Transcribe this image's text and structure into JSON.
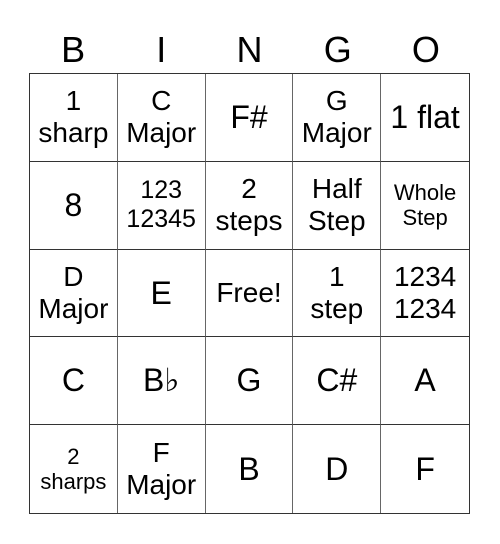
{
  "header": [
    "B",
    "I",
    "N",
    "G",
    "O"
  ],
  "cells": [
    {
      "text": "1\nsharp",
      "size": "m"
    },
    {
      "text": "C\nMajor",
      "size": "m"
    },
    {
      "text": "F#",
      "size": "l"
    },
    {
      "text": "G\nMajor",
      "size": "m"
    },
    {
      "text": "1 flat",
      "size": "l"
    },
    {
      "text": "8",
      "size": "l"
    },
    {
      "text": "123\n12345",
      "size": "s"
    },
    {
      "text": "2\nsteps",
      "size": "m"
    },
    {
      "text": "Half\nStep",
      "size": "m"
    },
    {
      "text": "Whole\nStep",
      "size": "xs"
    },
    {
      "text": "D\nMajor",
      "size": "m"
    },
    {
      "text": "E",
      "size": "l"
    },
    {
      "text": "Free!",
      "size": "m"
    },
    {
      "text": "1\nstep",
      "size": "m"
    },
    {
      "text": "1234\n1234",
      "size": "m"
    },
    {
      "text": "C",
      "size": "l"
    },
    {
      "text": "B♭",
      "size": "l"
    },
    {
      "text": "G",
      "size": "l"
    },
    {
      "text": "C#",
      "size": "l"
    },
    {
      "text": "A",
      "size": "l"
    },
    {
      "text": "2\nsharps",
      "size": "xs"
    },
    {
      "text": "F\nMajor",
      "size": "m"
    },
    {
      "text": "B",
      "size": "l"
    },
    {
      "text": "D",
      "size": "l"
    },
    {
      "text": "F",
      "size": "l"
    }
  ]
}
